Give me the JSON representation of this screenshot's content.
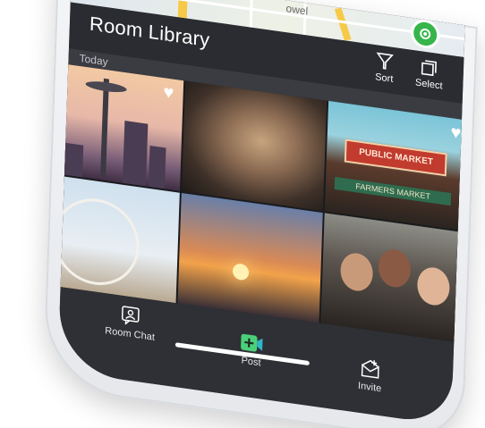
{
  "map": {
    "label": "owel"
  },
  "header": {
    "title": "Room Library",
    "sort_label": "Sort",
    "select_label": "Select"
  },
  "section": {
    "label": "Today"
  },
  "photos": [
    {
      "name": "space-needle",
      "favorited": true
    },
    {
      "name": "abstract-light",
      "favorited": false
    },
    {
      "name": "public-market",
      "favorited": true,
      "sign_text": "PUBLIC MARKET",
      "sign_text_2": "FARMERS MARKET"
    },
    {
      "name": "ferris-wheel",
      "favorited": false
    },
    {
      "name": "sunset-harbor",
      "favorited": false
    },
    {
      "name": "group-selfie",
      "favorited": false
    }
  ],
  "tabbar": {
    "room_chat_label": "Room Chat",
    "post_label": "Post",
    "invite_label": "Invite"
  },
  "colors": {
    "app_bg": "#2a2c31",
    "post_accent": "#4bd07a",
    "map_pin": "#35b54a"
  }
}
